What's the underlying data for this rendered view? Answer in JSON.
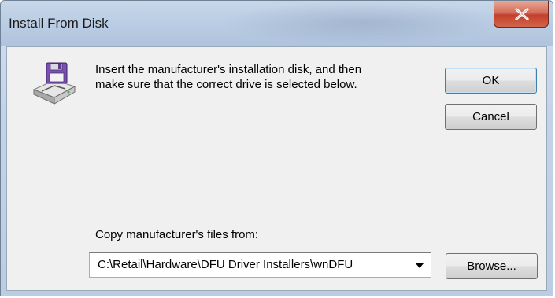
{
  "window": {
    "title": "Install From Disk",
    "close_icon": "close-icon"
  },
  "dialog": {
    "icon": "floppy-disk-drive-icon",
    "message_line1": "Insert the manufacturer's installation disk, and then",
    "message_line2": "make sure that the correct drive is selected below.",
    "ok_label": "OK",
    "cancel_label": "Cancel",
    "copy_label": "Copy manufacturer's files from:",
    "path_value": "C:\\Retail\\Hardware\\DFU Driver Installers\\wnDFU_",
    "browse_label": "Browse..."
  },
  "colors": {
    "close_button": "#c4402a",
    "window_frame": "#bccde3",
    "client_bg": "#f0f0f0",
    "default_button_border": "#3c7fb1"
  }
}
